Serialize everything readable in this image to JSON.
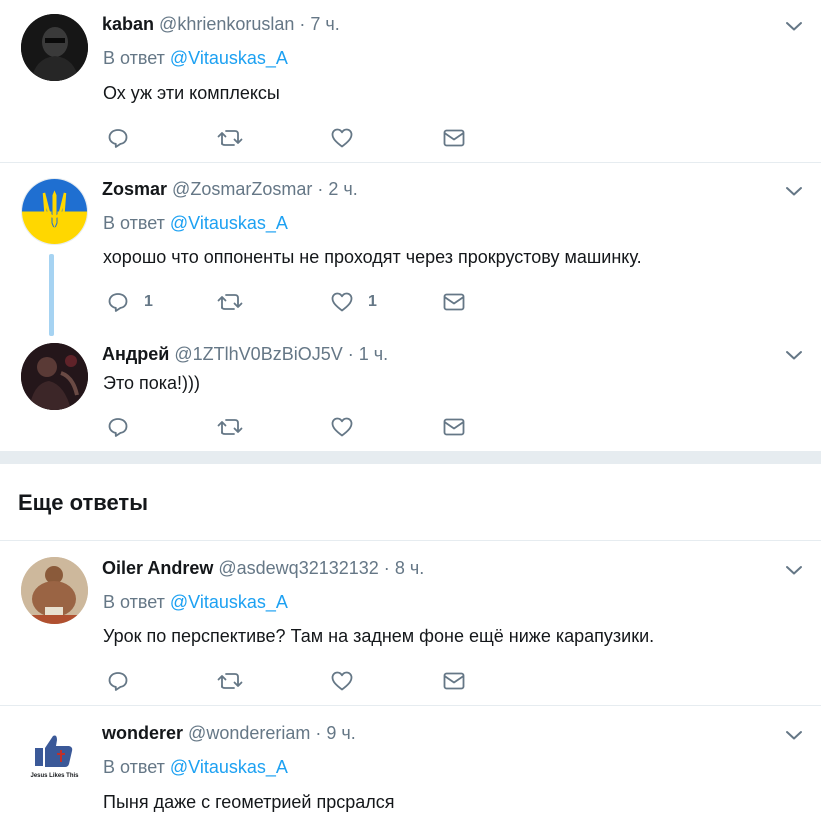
{
  "tweets": [
    {
      "name": "kaban",
      "handle": "@khrienkoruslan",
      "dot": "·",
      "time": "7 ч.",
      "reply_prefix": "В ответ",
      "reply_mention": "@Vitauskas_A",
      "text": "Ох уж эти комплексы",
      "reply_count": "",
      "retweet_count": "",
      "like_count": ""
    },
    {
      "name": "Zosmar",
      "handle": "@ZosmarZosmar",
      "dot": "·",
      "time": "2 ч.",
      "reply_prefix": "В ответ",
      "reply_mention": "@Vitauskas_A",
      "text": "хорошо что оппоненты не проходят через прокрустову машинку.",
      "reply_count": "1",
      "retweet_count": "",
      "like_count": "1"
    },
    {
      "name": "Андрей",
      "handle": "@1ZTlhV0BzBiOJ5V",
      "dot": "·",
      "time": "1 ч.",
      "text": "Это пока!)))",
      "reply_count": "",
      "retweet_count": "",
      "like_count": ""
    }
  ],
  "more_replies_title": "Еще ответы",
  "more_tweets": [
    {
      "name": "Oiler Andrew",
      "handle": "@asdewq32132132",
      "dot": "·",
      "time": "8 ч.",
      "reply_prefix": "В ответ",
      "reply_mention": "@Vitauskas_A",
      "text": "Урок по перспективе? Там на заднем фоне ещё ниже карапузики.",
      "reply_count": "",
      "retweet_count": "",
      "like_count": ""
    },
    {
      "name": "wonderer",
      "handle": "@wondereriam",
      "dot": "·",
      "time": "9 ч.",
      "reply_prefix": "В ответ",
      "reply_mention": "@Vitauskas_A",
      "text": "Пыня даже с геометрией прсрался",
      "avatar_caption": "Jesus Likes This"
    }
  ],
  "colors": {
    "link": "#1da1f2",
    "secondary_text": "#657786",
    "primary_text": "#14171a",
    "divider": "#e6ecf0",
    "thread_line": "#a6d3f2"
  },
  "icons": {
    "reply": "reply-icon",
    "retweet": "retweet-icon",
    "like": "heart-icon",
    "dm": "envelope-icon",
    "more": "chevron-down-icon"
  }
}
